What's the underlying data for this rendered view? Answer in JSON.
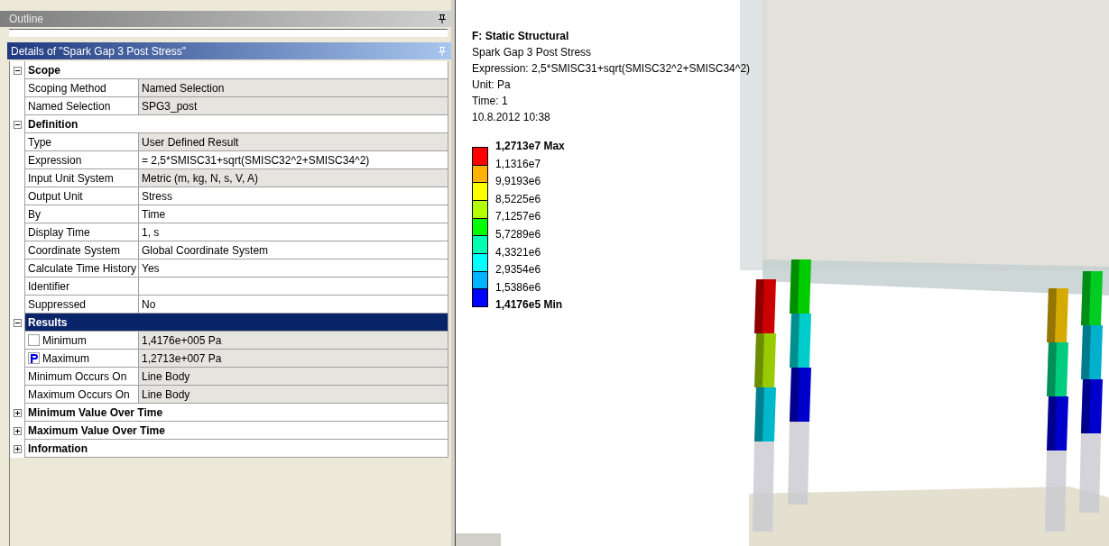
{
  "outline": {
    "title": "Outline"
  },
  "details": {
    "title": "Details of \"Spark Gap 3 Post Stress\"",
    "sections": [
      {
        "title": "Scope",
        "expanded": true,
        "selected": false,
        "rows": [
          {
            "kind": "property",
            "label": "Scoping Method",
            "value": "Named Selection",
            "readonly": true
          },
          {
            "kind": "property",
            "label": "Named Selection",
            "value": "SPG3_post",
            "readonly": true
          }
        ]
      },
      {
        "title": "Definition",
        "expanded": true,
        "selected": false,
        "rows": [
          {
            "kind": "property",
            "label": "Type",
            "value": "User Defined Result",
            "readonly": true
          },
          {
            "kind": "property",
            "label": "Expression",
            "value": "= 2,5*SMISC31+sqrt(SMISC32^2+SMISC34^2)",
            "readonly": false
          },
          {
            "kind": "property",
            "label": "Input Unit System",
            "value": "Metric (m, kg, N, s, V, A)",
            "readonly": true
          },
          {
            "kind": "property",
            "label": "Output Unit",
            "value": "Stress",
            "readonly": false
          },
          {
            "kind": "property",
            "label": "By",
            "value": "Time",
            "readonly": false
          },
          {
            "kind": "property",
            "label": "Display Time",
            "value": "1, s",
            "readonly": false
          },
          {
            "kind": "property",
            "label": "Coordinate System",
            "value": "Global Coordinate System",
            "readonly": false
          },
          {
            "kind": "property",
            "label": "Calculate Time History",
            "value": "Yes",
            "readonly": false
          },
          {
            "kind": "property",
            "label": "Identifier",
            "readonly": false
          },
          {
            "kind": "property",
            "label": "Suppressed",
            "value": "No",
            "readonly": false
          }
        ]
      },
      {
        "title": "Results",
        "expanded": true,
        "selected": true,
        "rows": [
          {
            "kind": "parameter",
            "label": "Minimum",
            "value": "1,4176e+005 Pa",
            "readonly": true,
            "checked": false
          },
          {
            "kind": "parameter",
            "label": "Maximum",
            "value": "1,2713e+007 Pa",
            "readonly": true,
            "checked": true
          },
          {
            "kind": "property",
            "label": "Minimum Occurs On",
            "value": "Line Body",
            "readonly": true
          },
          {
            "kind": "property",
            "label": "Maximum Occurs On",
            "value": "Line Body",
            "readonly": true
          }
        ]
      },
      {
        "title": "Minimum Value Over Time",
        "expanded": false,
        "selected": false
      },
      {
        "title": "Maximum Value Over Time",
        "expanded": false,
        "selected": false
      },
      {
        "title": "Information",
        "expanded": false,
        "selected": false
      }
    ]
  },
  "viewport": {
    "title": "F: Static Structural",
    "lines": [
      "Spark Gap 3 Post Stress",
      "Expression: 2,5*SMISC31+sqrt(SMISC32^2+SMISC34^2)",
      "Unit: Pa",
      "Time: 1",
      "10.8.2012 10:38"
    ],
    "legend": {
      "bands": [
        {
          "color": "#ff0000"
        },
        {
          "color": "#ffb300"
        },
        {
          "color": "#ffff00"
        },
        {
          "color": "#b3ff00"
        },
        {
          "color": "#00ff00"
        },
        {
          "color": "#00ffb3"
        },
        {
          "color": "#00ffff"
        },
        {
          "color": "#00b3ff"
        },
        {
          "color": "#0000ff"
        }
      ],
      "labels": [
        {
          "kind": "bound",
          "text": "1,2713e7 Max"
        },
        {
          "kind": "value",
          "text": "1,1316e7"
        },
        {
          "kind": "value",
          "text": "9,9193e6"
        },
        {
          "kind": "value",
          "text": "8,5225e6"
        },
        {
          "kind": "value",
          "text": "7,1257e6"
        },
        {
          "kind": "value",
          "text": "5,7289e6"
        },
        {
          "kind": "value",
          "text": "4,3321e6"
        },
        {
          "kind": "value",
          "text": "2,9354e6"
        },
        {
          "kind": "value",
          "text": "1,5386e6"
        },
        {
          "kind": "bound",
          "text": "1,4176e5 Min"
        }
      ]
    }
  }
}
